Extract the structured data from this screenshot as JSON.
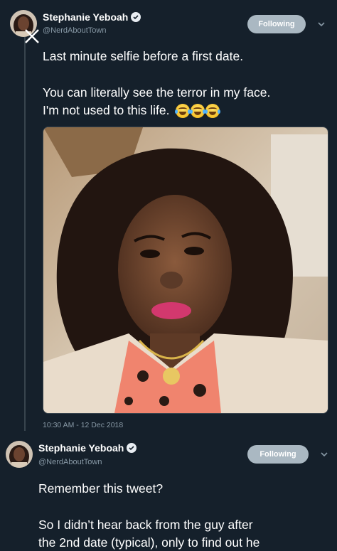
{
  "tweet1": {
    "display_name": "Stephanie Yeboah",
    "handle": "@NerdAboutTown",
    "follow_label": "Following",
    "text_line1": "Last minute selfie before a first date.",
    "text_line2": "You can literally see the terror in my face.",
    "text_line3": "I'm not used to this life.",
    "emojis": [
      "face-with-tears-of-joy-emoji",
      "face-with-tears-of-joy-emoji",
      "face-with-tears-of-joy-emoji"
    ],
    "timestamp": "10:30 AM - 12 Dec 2018"
  },
  "tweet2": {
    "display_name": "Stephanie Yeboah",
    "handle": "@NerdAboutTown",
    "follow_label": "Following",
    "text_line1": "Remember this tweet?",
    "text_line2": "So I didn’t hear back from the guy after",
    "text_line3": "the 2nd date (typical), only to find out he"
  },
  "colors": {
    "background": "#15202b",
    "secondary_text": "#8899a6",
    "follow_button": "#aab8c2",
    "divider": "#38444d"
  }
}
